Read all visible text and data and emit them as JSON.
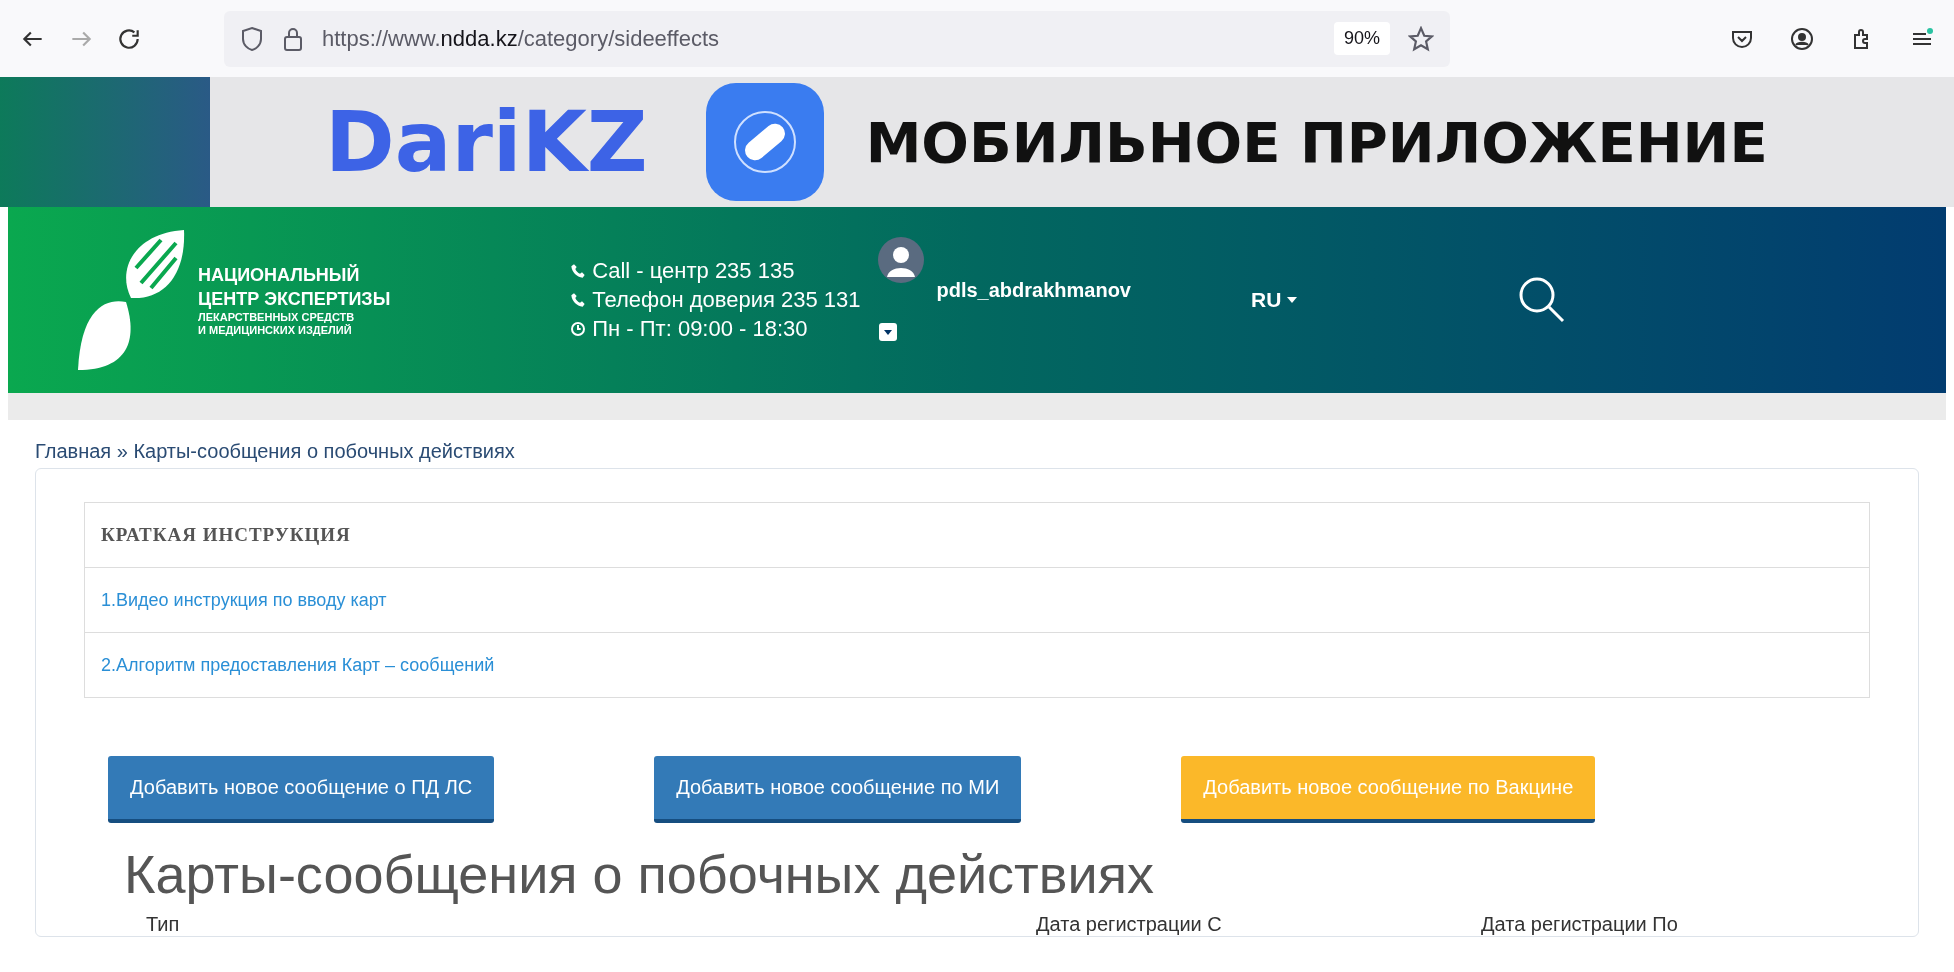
{
  "browser": {
    "url_prefix": "https://www.",
    "url_domain": "ndda.kz",
    "url_path": "/category/sideeffects",
    "zoom": "90%"
  },
  "banner": {
    "brand": "DariKZ",
    "slogan": "МОБИЛЬНОЕ ПРИЛОЖЕНИЕ"
  },
  "header": {
    "org_lines": [
      "НАЦИОНАЛЬНЫЙ",
      "ЦЕНТР ЭКСПЕРТИЗЫ"
    ],
    "org_sub": [
      "ЛЕКАРСТВЕННЫХ СРЕДСТВ",
      "И МЕДИЦИНСКИХ ИЗДЕЛИЙ"
    ],
    "contacts": [
      {
        "kind": "phone",
        "text": "Call - центр 235 135"
      },
      {
        "kind": "phone",
        "text": "Телефон доверия 235 131"
      },
      {
        "kind": "clock",
        "text": "Пн - Пт: 09:00 - 18:30"
      }
    ],
    "user": "pdls_abdrakhmanov",
    "language": "RU"
  },
  "breadcrumb": {
    "separator": "»",
    "items": [
      "Главная",
      "Карты-сообщения о побочных действиях"
    ]
  },
  "instructions": {
    "title": "КРАТКАЯ ИНСТРУКЦИЯ",
    "links": [
      "1.Видео инструкция по вводу карт",
      "2.Алгоритм предоставления Карт – сообщений"
    ]
  },
  "buttons": [
    {
      "label": "Добавить новое сообщение о ПД ЛС",
      "kind": "primary"
    },
    {
      "label": "Добавить новое сообщение по МИ",
      "kind": "primary"
    },
    {
      "label": "Добавить новое сообщение по Вакцине",
      "kind": "warning"
    }
  ],
  "heading": "Карты-сообщения о побочных действиях",
  "filters": [
    "Тип",
    "Дата регистрации С",
    "Дата регистрации По"
  ]
}
